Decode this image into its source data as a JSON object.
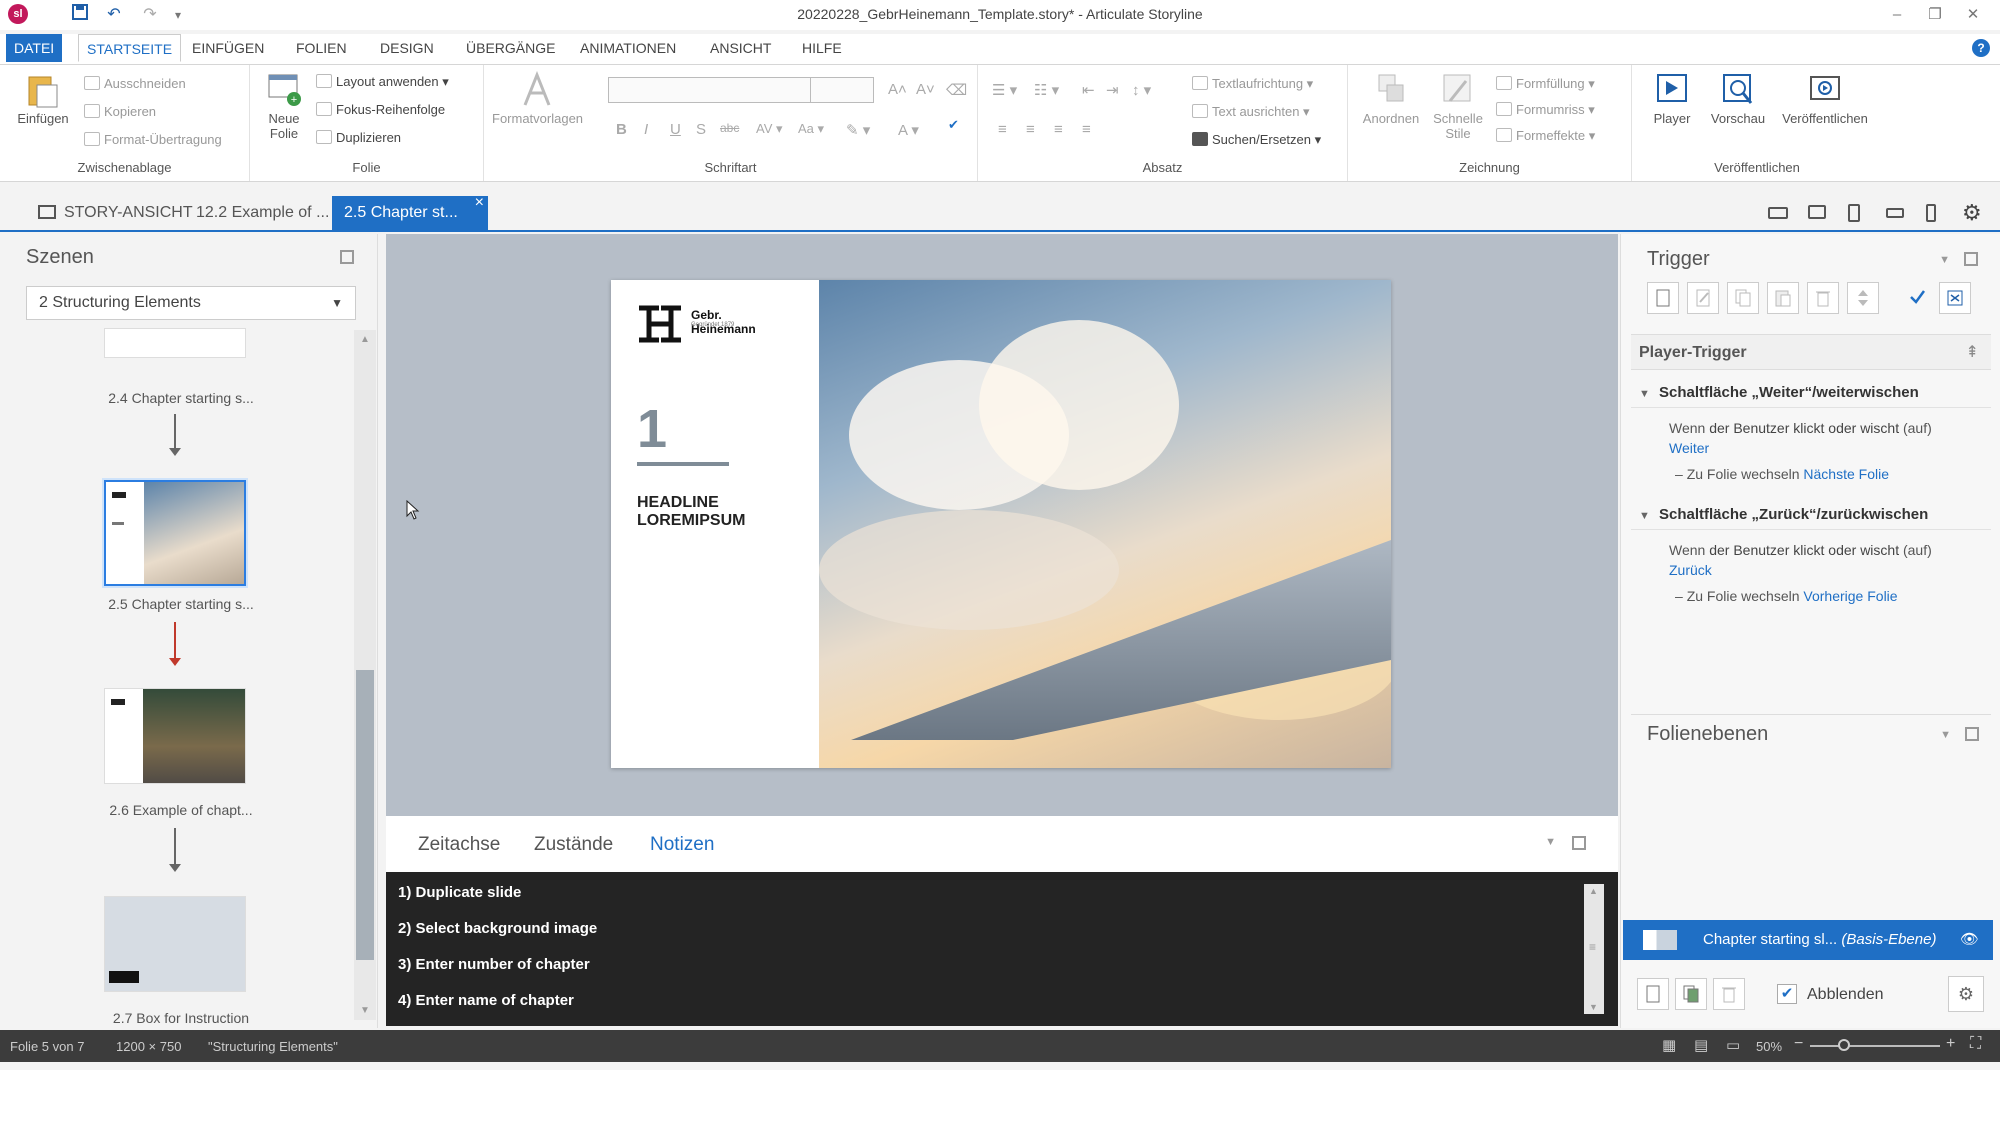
{
  "app": {
    "title": "20220228_GebrHeinemann_Template.story* - Articulate Storyline",
    "logo_text": "sl",
    "window_controls": [
      "–",
      "❐",
      "✕"
    ]
  },
  "ribbon_tabs": [
    "DATEI",
    "STARTSEITE",
    "EINFÜGEN",
    "FOLIEN",
    "DESIGN",
    "ÜBERGÄNGE",
    "ANIMATIONEN",
    "ANSICHT",
    "HILFE"
  ],
  "ribbon": {
    "clipboard": {
      "paste": "Einfügen",
      "cut": "Ausschneiden",
      "copy": "Kopieren",
      "format_painter": "Format-Übertragung",
      "label": "Zwischenablage"
    },
    "slide": {
      "new_slide_1": "Neue",
      "new_slide_2": "Folie",
      "apply_layout": "Layout anwenden",
      "focus_order": "Fokus-Reihenfolge",
      "duplicate": "Duplizieren",
      "label": "Folie"
    },
    "font": {
      "styles": "Formatvorlagen",
      "label": "Schriftart"
    },
    "paragraph": {
      "text_direction": "Textlaufrichtung",
      "align_text": "Text ausrichten",
      "find_replace": "Suchen/Ersetzen",
      "label": "Absatz"
    },
    "drawing": {
      "arrange": "Anordnen",
      "quick_styles_1": "Schnelle",
      "quick_styles_2": "Stile",
      "shape_fill": "Formfüllung",
      "shape_outline": "Formumriss",
      "shape_effects": "Formeffekte",
      "label": "Zeichnung"
    },
    "publish": {
      "player": "Player",
      "preview": "Vorschau",
      "publish": "Veröffentlichen",
      "label": "Veröffentlichen"
    }
  },
  "doc_tabs": {
    "story_view": "STORY-ANSICHT",
    "tab1": "12.2 Example of ...",
    "tab2": "2.5 Chapter st...",
    "close": "×"
  },
  "scenes": {
    "title": "Szenen",
    "selected_scene": "2 Structuring Elements",
    "slides": [
      {
        "label": "2.4 Chapter starting s..."
      },
      {
        "label": "2.5 Chapter starting s..."
      },
      {
        "label": "2.6 Example of chapt..."
      },
      {
        "label": "2.7 Box for Instruction"
      }
    ]
  },
  "slide": {
    "brand_name": "Gebr. Heinemann",
    "brand_sub": "Gegründet 1879",
    "number": "1",
    "headline_1": "HEADLINE",
    "headline_2": "LOREMIPSUM"
  },
  "bottom_tabs": {
    "timeline": "Zeitachse",
    "states": "Zustände",
    "notes": "Notizen"
  },
  "notes": [
    "1) Duplicate slide",
    "2) Select background image",
    "3) Enter number of chapter",
    "4) Enter name of chapter"
  ],
  "triggers": {
    "title": "Trigger",
    "player_triggers": "Player-Trigger",
    "sections": [
      {
        "name": "Schaltfläche „Weiter“/weiterwischen",
        "when_1": "Wenn",
        "when_2": "der Benutzer",
        "when_3": "klickt oder wischt",
        "when_4": "(auf)",
        "object": "Weiter",
        "action_1": "Zu Folie wechseln",
        "action_2": "Nächste Folie"
      },
      {
        "name": "Schaltfläche „Zurück“/zurückwischen",
        "when_1": "Wenn",
        "when_2": "der Benutzer",
        "when_3": "klickt oder wischt",
        "when_4": "(auf)",
        "object": "Zurück",
        "action_1": "Zu Folie wechseln",
        "action_2": "Vorherige Folie"
      }
    ]
  },
  "layers": {
    "title": "Folienebenen",
    "base_layer_name": "Chapter starting sl...",
    "base_layer_tag": "(Basis-Ebene)",
    "fade_label": "Abblenden"
  },
  "status": {
    "slide_of": "Folie 5 von 7",
    "size": "1200 × 750",
    "scene": "\"Structuring Elements\"",
    "zoom": "50%"
  },
  "colors": {
    "accent": "#1f6fc5",
    "notes_bg": "#242424",
    "statusbar_bg": "#3c3c3c"
  }
}
